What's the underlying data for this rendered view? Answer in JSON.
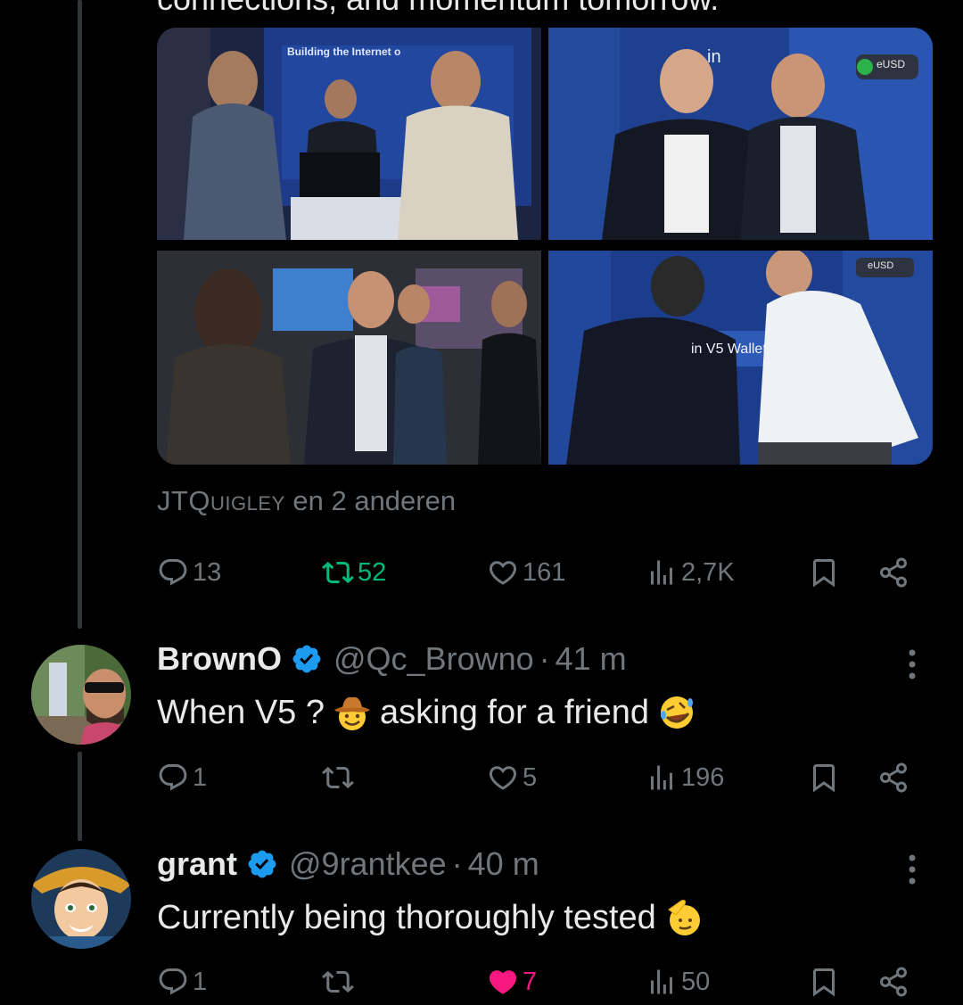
{
  "main_tweet": {
    "text_cut": "connections, and momentum tomorrow.",
    "tagged": {
      "name": "JTQuigley",
      "suffix": "en 2 anderen"
    },
    "actions": {
      "replies": "13",
      "reposts": "52",
      "likes": "161",
      "views": "2,7K"
    },
    "photos": [
      {
        "sign_text": "Building the Internet o"
      },
      {
        "sign_text": "in",
        "badge": "eUSD"
      },
      {
        "sign_text": ""
      },
      {
        "sign_text": "in V5 Wallet",
        "badge": "eUSD"
      }
    ]
  },
  "replies": [
    {
      "name": "BrownO",
      "handle": "@Qc_Browno",
      "separator": "·",
      "time": "41 m",
      "text_before": "When V5 ?",
      "text_after": "asking for a friend",
      "actions": {
        "replies": "1",
        "reposts": "",
        "likes": "5",
        "views": "196"
      }
    },
    {
      "name": "grant",
      "handle": "@9rantkee",
      "separator": "·",
      "time": "40 m",
      "text_before": "Currently being thoroughly tested",
      "text_after": "",
      "actions": {
        "replies": "1",
        "reposts": "",
        "likes": "7",
        "views": "50"
      }
    }
  ],
  "colors": {
    "background": "#000000",
    "text": "#e7e9ea",
    "muted": "#71767b",
    "repost_active": "#00ba7c",
    "like_active": "#f91880",
    "verified": "#1d9bf0"
  },
  "icons": [
    "reply-icon",
    "repost-icon",
    "like-icon",
    "views-icon",
    "bookmark-icon",
    "share-icon",
    "verified-badge-icon",
    "more-icon"
  ]
}
